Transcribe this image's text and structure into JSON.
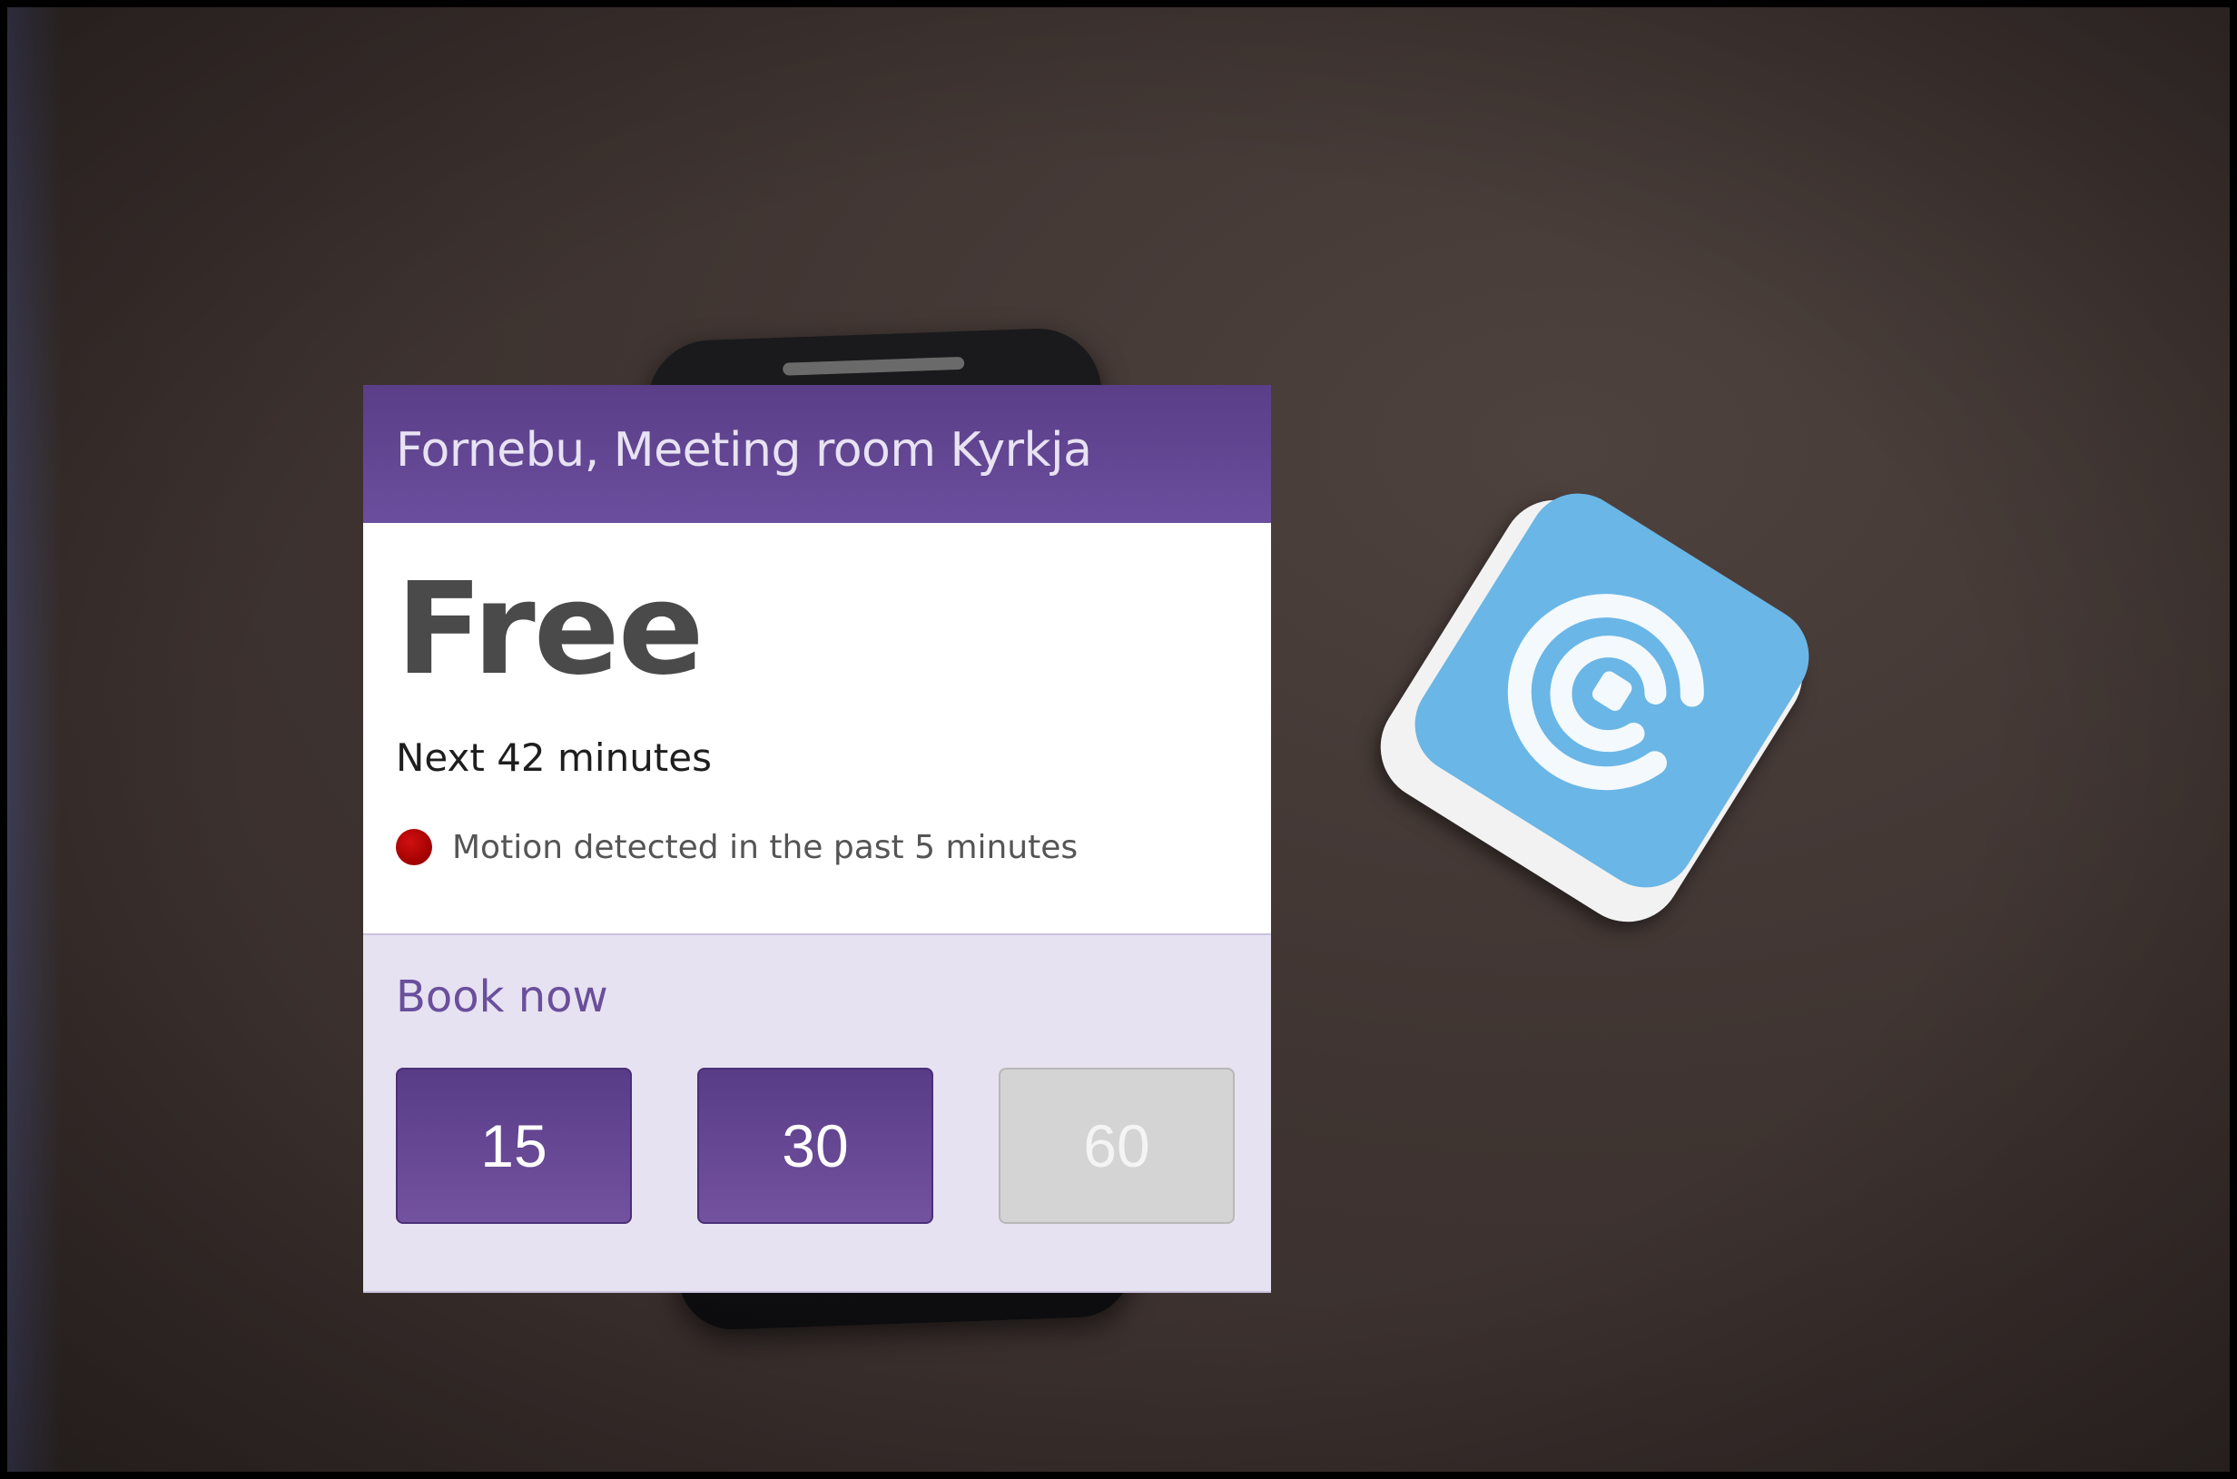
{
  "card": {
    "location_title": "Fornebu, Meeting room Kyrkja",
    "status": "Free",
    "duration": "Next 42 minutes",
    "motion": {
      "text": "Motion detected in the past 5 minutes",
      "indicator_color": "#b00000"
    },
    "booking": {
      "label": "Book now",
      "options": [
        {
          "label": "15",
          "enabled": true
        },
        {
          "label": "30",
          "enabled": true
        },
        {
          "label": "60",
          "enabled": false
        }
      ]
    },
    "colors": {
      "header": "#5f4390",
      "accent": "#6b4e9d",
      "booking_bg": "#e7e2f1",
      "disabled_button": "#d4d4d4"
    }
  },
  "background": {
    "device_icon": "beacon-logo-icon"
  }
}
